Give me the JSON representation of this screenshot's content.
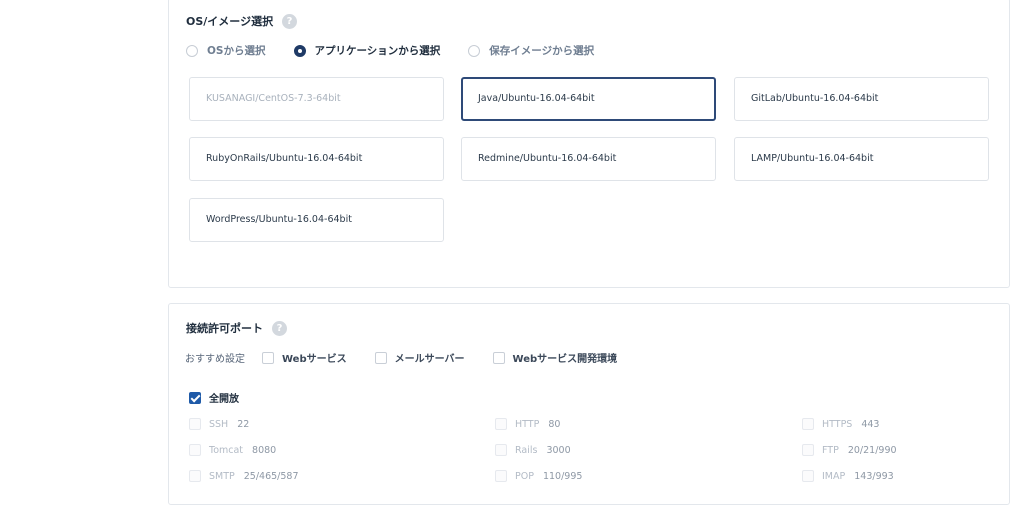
{
  "os_section": {
    "title": "OS/イメージ選択",
    "help": "?",
    "radios": [
      {
        "label": "OSから選択",
        "checked": false
      },
      {
        "label": "アプリケーションから選択",
        "checked": true
      },
      {
        "label": "保存イメージから選択",
        "checked": false
      }
    ],
    "images": [
      {
        "label": "KUSANAGI/CentOS-7.3-64bit",
        "state": "disabled"
      },
      {
        "label": "Java/Ubuntu-16.04-64bit",
        "state": "selected"
      },
      {
        "label": "GitLab/Ubuntu-16.04-64bit",
        "state": "normal"
      },
      {
        "label": "RubyOnRails/Ubuntu-16.04-64bit",
        "state": "normal"
      },
      {
        "label": "Redmine/Ubuntu-16.04-64bit",
        "state": "normal"
      },
      {
        "label": "LAMP/Ubuntu-16.04-64bit",
        "state": "normal"
      },
      {
        "label": "WordPress/Ubuntu-16.04-64bit",
        "state": "normal"
      }
    ]
  },
  "port_section": {
    "title": "接続許可ポート",
    "help": "?",
    "recommended_label": "おすすめ設定",
    "recommended": [
      {
        "label": "Webサービス",
        "checked": false
      },
      {
        "label": "メールサーバー",
        "checked": false
      },
      {
        "label": "Webサービス開発環境",
        "checked": false
      }
    ],
    "all_open": {
      "label": "全開放",
      "checked": true
    },
    "ports": [
      {
        "name": "SSH",
        "number": "22"
      },
      {
        "name": "HTTP",
        "number": "80"
      },
      {
        "name": "HTTPS",
        "number": "443"
      },
      {
        "name": "Tomcat",
        "number": "8080"
      },
      {
        "name": "Rails",
        "number": "3000"
      },
      {
        "name": "FTP",
        "number": "20/21/990"
      },
      {
        "name": "SMTP",
        "number": "25/465/587"
      },
      {
        "name": "POP",
        "number": "110/995"
      },
      {
        "name": "IMAP",
        "number": "143/993"
      }
    ]
  },
  "colors": {
    "accent": "#1f3a66",
    "checkbox_checked": "#1f5aa8",
    "border": "#e3e7ec"
  }
}
